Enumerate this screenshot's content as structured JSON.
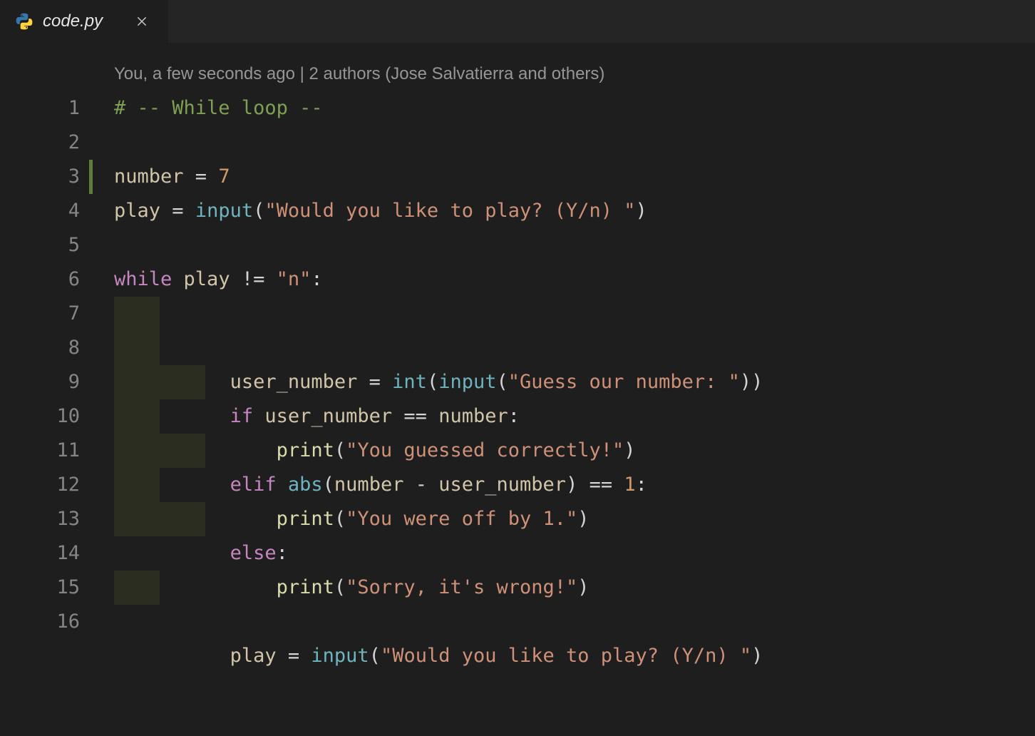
{
  "tab": {
    "file_name": "code.py",
    "close_title": "Close"
  },
  "codelens": {
    "text": "You, a few seconds ago | 2 authors (Jose Salvatierra and others)"
  },
  "line_numbers": [
    "1",
    "2",
    "3",
    "4",
    "5",
    "6",
    "7",
    "8",
    "9",
    "10",
    "11",
    "12",
    "13",
    "14",
    "15",
    "16"
  ],
  "code": {
    "l1_comment": "# -- While loop --",
    "l3_var": "number",
    "l3_eq": " = ",
    "l3_val": "7",
    "l4_var": "play",
    "l4_eq": " = ",
    "l4_fn": "input",
    "l4_paren_o": "(",
    "l4_str": "\"Would you like to play? (Y/n) \"",
    "l4_paren_c": ")",
    "l6_kw": "while",
    "l6_sp": " ",
    "l6_var": "play",
    "l6_op": " != ",
    "l6_str": "\"n\"",
    "l6_colon": ":",
    "l7_indent": "    ",
    "l7_var": "user_number",
    "l7_eq": " = ",
    "l7_fn1": "int",
    "l7_po1": "(",
    "l7_fn2": "input",
    "l7_po2": "(",
    "l7_str": "\"Guess our number: \"",
    "l7_pc": "))",
    "l8_indent": "    ",
    "l8_kw": "if",
    "l8_sp": " ",
    "l8_var1": "user_number",
    "l8_op": " == ",
    "l8_var2": "number",
    "l8_colon": ":",
    "l9_indent": "        ",
    "l9_fn": "print",
    "l9_po": "(",
    "l9_str": "\"You guessed correctly!\"",
    "l9_pc": ")",
    "l10_indent": "    ",
    "l10_kw": "elif",
    "l10_sp": " ",
    "l10_fn": "abs",
    "l10_po": "(",
    "l10_var1": "number",
    "l10_op1": " - ",
    "l10_var2": "user_number",
    "l10_pc": ")",
    "l10_op2": " == ",
    "l10_num": "1",
    "l10_colon": ":",
    "l11_indent": "        ",
    "l11_fn": "print",
    "l11_po": "(",
    "l11_str": "\"You were off by 1.\"",
    "l11_pc": ")",
    "l12_indent": "    ",
    "l12_kw": "else",
    "l12_colon": ":",
    "l13_indent": "        ",
    "l13_fn": "print",
    "l13_po": "(",
    "l13_str": "\"Sorry, it's wrong!\"",
    "l13_pc": ")",
    "l15_indent": "    ",
    "l15_var": "play",
    "l15_eq": " = ",
    "l15_fn": "input",
    "l15_po": "(",
    "l15_str": "\"Would you like to play? (Y/n) \"",
    "l15_pc": ")"
  }
}
